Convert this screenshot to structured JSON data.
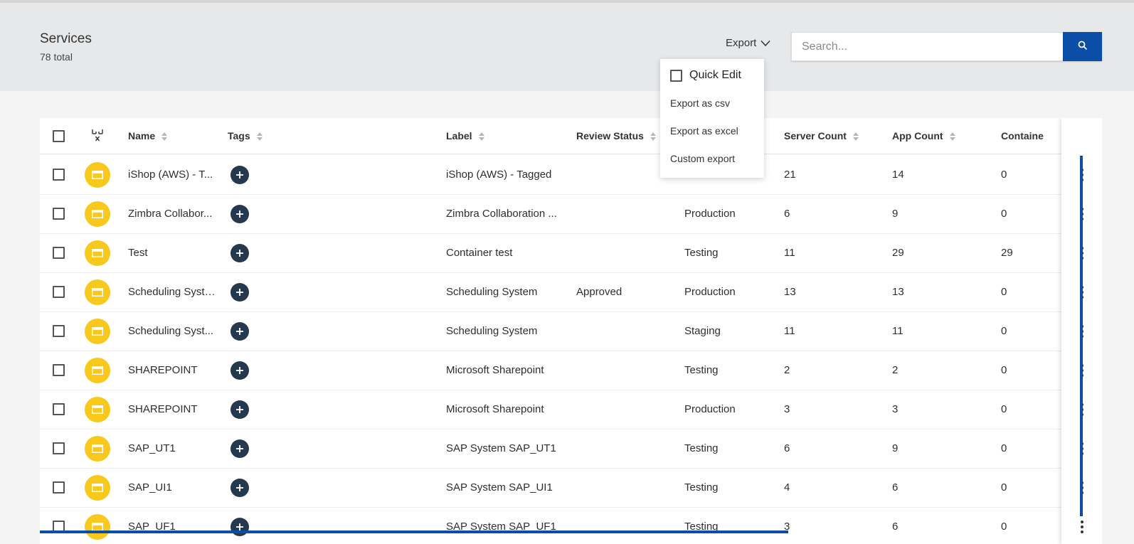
{
  "header": {
    "title": "Services",
    "subtitle": "78 total",
    "export_label": "Export",
    "search_placeholder": "Search..."
  },
  "export_menu": {
    "quick_edit_label": "Quick Edit",
    "quick_edit_checked": false,
    "items": [
      "Export as csv",
      "Export as excel",
      "Custom export"
    ]
  },
  "table": {
    "columns": {
      "name": "Name",
      "tags": "Tags",
      "label": "Label",
      "review_status": "Review Status",
      "server_count": "Server Count",
      "app_count": "App Count",
      "container_count": "Containe"
    },
    "rows": [
      {
        "name": "iShop (AWS) - T...",
        "label": "iShop (AWS) - Tagged",
        "review": "",
        "environment": "",
        "server": "21",
        "app": "14",
        "container": "0"
      },
      {
        "name": "Zimbra Collabor...",
        "label": "Zimbra Collaboration ...",
        "review": "",
        "environment": "Production",
        "server": "6",
        "app": "9",
        "container": "0"
      },
      {
        "name": "Test",
        "label": "Container test",
        "review": "",
        "environment": "Testing",
        "server": "11",
        "app": "29",
        "container": "29"
      },
      {
        "name": "Scheduling Syste...",
        "label": "Scheduling System",
        "review": "Approved",
        "environment": "Production",
        "server": "13",
        "app": "13",
        "container": "0"
      },
      {
        "name": "Scheduling Syst...",
        "label": "Scheduling System",
        "review": "",
        "environment": "Staging",
        "server": "11",
        "app": "11",
        "container": "0"
      },
      {
        "name": "SHAREPOINT",
        "label": "Microsoft Sharepoint",
        "review": "",
        "environment": "Testing",
        "server": "2",
        "app": "2",
        "container": "0"
      },
      {
        "name": "SHAREPOINT",
        "label": "Microsoft Sharepoint",
        "review": "",
        "environment": "Production",
        "server": "3",
        "app": "3",
        "container": "0"
      },
      {
        "name": "SAP_UT1",
        "label": "SAP System SAP_UT1",
        "review": "",
        "environment": "Testing",
        "server": "6",
        "app": "9",
        "container": "0"
      },
      {
        "name": "SAP_UI1",
        "label": "SAP System SAP_UI1",
        "review": "",
        "environment": "Testing",
        "server": "4",
        "app": "6",
        "container": "0"
      },
      {
        "name": "SAP_UF1",
        "label": "SAP System SAP_UF1",
        "review": "",
        "environment": "Testing",
        "server": "3",
        "app": "6",
        "container": "0"
      }
    ]
  },
  "colors": {
    "accent": "#0a4ea8",
    "service_icon": "#f8c81c",
    "tag_button": "#24384e"
  }
}
